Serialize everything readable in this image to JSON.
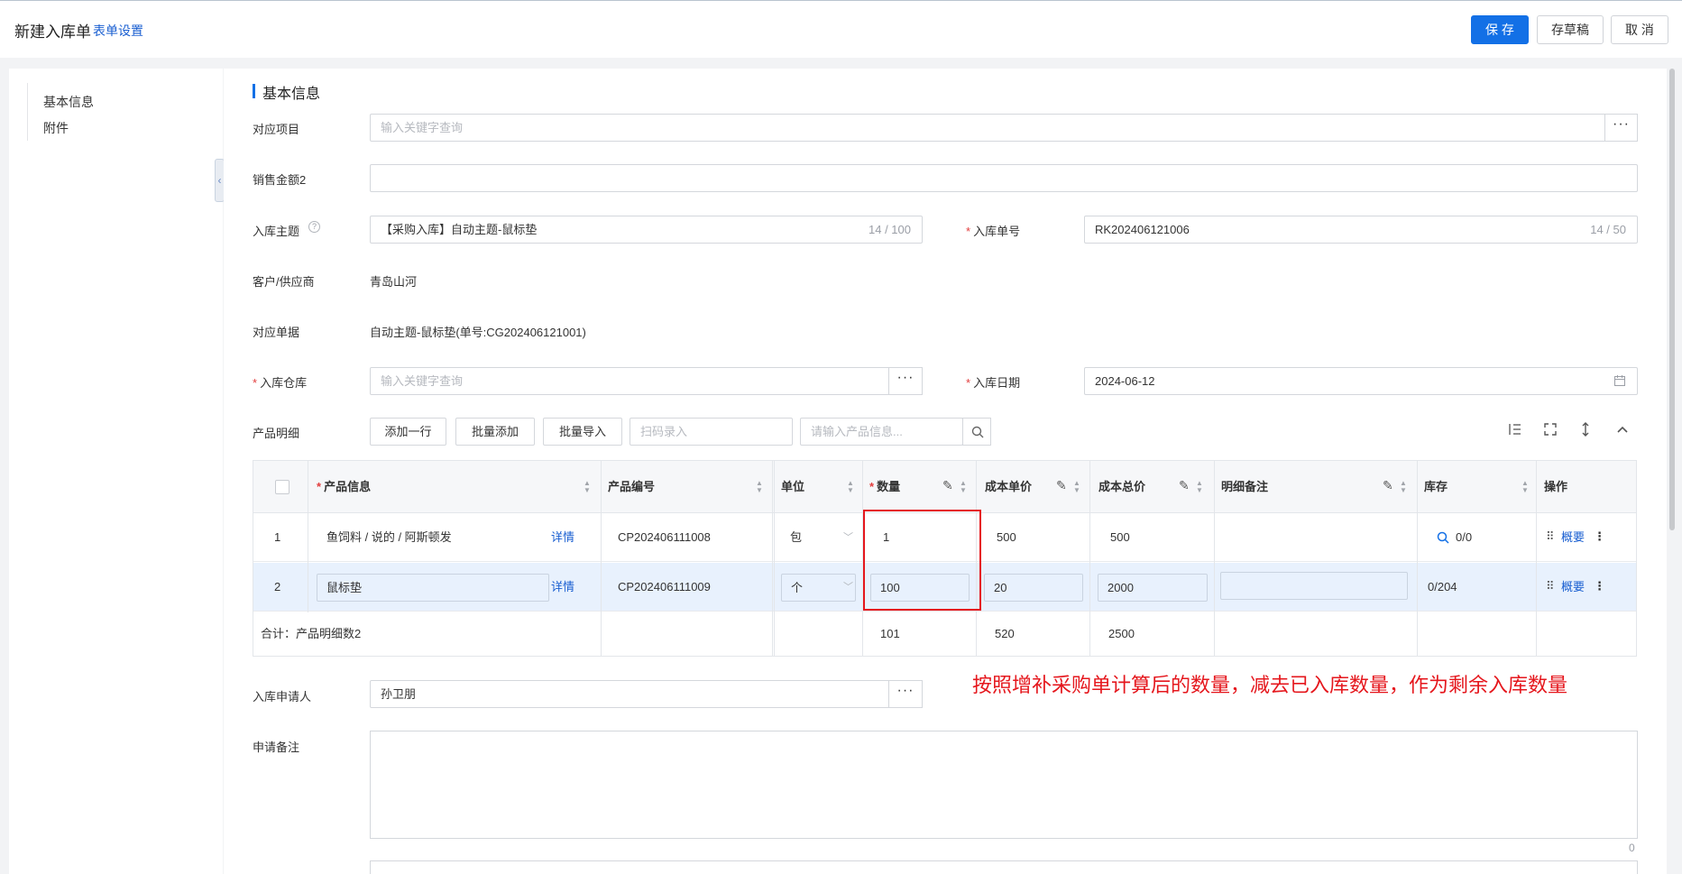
{
  "header": {
    "title": "新建入库单",
    "form_settings": "表单设置",
    "save": "保 存",
    "draft": "存草稿",
    "cancel": "取 消"
  },
  "sidebar": {
    "items": [
      "基本信息",
      "附件"
    ]
  },
  "section": {
    "title": "基本信息"
  },
  "form": {
    "project": {
      "label": "对应项目",
      "placeholder": "输入关键字查询"
    },
    "sales_amount": {
      "label": "销售金额2",
      "value": ""
    },
    "subject": {
      "label": "入库主题",
      "value": "【采购入库】自动主题-鼠标垫",
      "count": "14 / 100"
    },
    "order_no": {
      "label": "入库单号",
      "value": "RK202406121006",
      "count": "14 / 50"
    },
    "customer": {
      "label": "客户/供应商",
      "value": "青岛山河"
    },
    "source_doc": {
      "label": "对应单据",
      "value": "自动主题-鼠标垫(单号:CG202406121001)"
    },
    "warehouse": {
      "label": "入库仓库",
      "placeholder": "输入关键字查询"
    },
    "date": {
      "label": "入库日期",
      "value": "2024-06-12"
    },
    "detail_label": "产品明细",
    "applicant": {
      "label": "入库申请人",
      "value": "孙卫朋"
    },
    "remark": {
      "label": "申请备注",
      "count": "0"
    }
  },
  "toolbar": {
    "add_row": "添加一行",
    "batch_add": "批量添加",
    "batch_import": "批量导入",
    "scan_placeholder": "扫码录入",
    "search_placeholder": "请输入产品信息..."
  },
  "table": {
    "headers": {
      "product": "产品信息",
      "code": "产品编号",
      "unit": "单位",
      "qty": "数量",
      "unit_cost": "成本单价",
      "total_cost": "成本总价",
      "remark": "明细备注",
      "stock": "库存",
      "ops": "操作"
    },
    "rows": [
      {
        "idx": "1",
        "product": "鱼饲料 / 说的 / 阿斯顿发",
        "detail": "详情",
        "code": "CP202406111008",
        "unit": "包",
        "qty": "1",
        "unit_cost": "500",
        "total_cost": "500",
        "remark": "",
        "stock": "0/0",
        "op": "概要"
      },
      {
        "idx": "2",
        "product": "鼠标垫",
        "detail": "详情",
        "code": "CP202406111009",
        "unit": "个",
        "qty": "100",
        "unit_cost": "20",
        "total_cost": "2000",
        "remark": "",
        "stock": "0/204",
        "op": "概要"
      }
    ],
    "summary": {
      "label": "合计：产品明细数2",
      "qty": "101",
      "unit_cost": "520",
      "total_cost": "2500"
    }
  },
  "annotation": "按照增补采购单计算后的数量，减去已入库数量，作为剩余入库数量",
  "colors": {
    "primary": "#1370e6",
    "link": "#1a5fd1",
    "highlight_row": "#e8f1fd",
    "annotation": "#e5171d"
  }
}
